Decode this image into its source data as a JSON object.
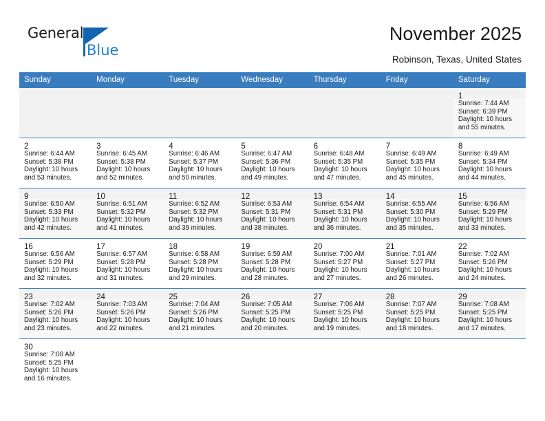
{
  "brand": {
    "name_part1": "General",
    "name_part2": "Blue",
    "triangle_color": "#1265b0",
    "blue_text_color": "#1f7fd0"
  },
  "header": {
    "title": "November 2025",
    "location": "Robinson, Texas, United States"
  },
  "theme": {
    "header_bg": "#3a7dbf",
    "header_text": "#ffffff",
    "cell_band_shaded": "#f2f2f2",
    "row_shaded_bg": "#f7f7f7",
    "grid_line": "#3a7dbf"
  },
  "weekdays": [
    "Sunday",
    "Monday",
    "Tuesday",
    "Wednesday",
    "Thursday",
    "Friday",
    "Saturday"
  ],
  "labels": {
    "sunrise_prefix": "Sunrise: ",
    "sunset_prefix": "Sunset: ",
    "daylight_prefix": "Daylight: "
  },
  "weeks": [
    {
      "shaded": true,
      "days": [
        null,
        null,
        null,
        null,
        null,
        null,
        {
          "day": "1",
          "sunrise": "Sunrise: 7:44 AM",
          "sunset": "Sunset: 6:39 PM",
          "daylight_line1": "Daylight: 10 hours",
          "daylight_line2": "and 55 minutes."
        }
      ]
    },
    {
      "shaded": false,
      "days": [
        {
          "day": "2",
          "sunrise": "Sunrise: 6:44 AM",
          "sunset": "Sunset: 5:38 PM",
          "daylight_line1": "Daylight: 10 hours",
          "daylight_line2": "and 53 minutes."
        },
        {
          "day": "3",
          "sunrise": "Sunrise: 6:45 AM",
          "sunset": "Sunset: 5:38 PM",
          "daylight_line1": "Daylight: 10 hours",
          "daylight_line2": "and 52 minutes."
        },
        {
          "day": "4",
          "sunrise": "Sunrise: 6:46 AM",
          "sunset": "Sunset: 5:37 PM",
          "daylight_line1": "Daylight: 10 hours",
          "daylight_line2": "and 50 minutes."
        },
        {
          "day": "5",
          "sunrise": "Sunrise: 6:47 AM",
          "sunset": "Sunset: 5:36 PM",
          "daylight_line1": "Daylight: 10 hours",
          "daylight_line2": "and 49 minutes."
        },
        {
          "day": "6",
          "sunrise": "Sunrise: 6:48 AM",
          "sunset": "Sunset: 5:35 PM",
          "daylight_line1": "Daylight: 10 hours",
          "daylight_line2": "and 47 minutes."
        },
        {
          "day": "7",
          "sunrise": "Sunrise: 6:49 AM",
          "sunset": "Sunset: 5:35 PM",
          "daylight_line1": "Daylight: 10 hours",
          "daylight_line2": "and 45 minutes."
        },
        {
          "day": "8",
          "sunrise": "Sunrise: 6:49 AM",
          "sunset": "Sunset: 5:34 PM",
          "daylight_line1": "Daylight: 10 hours",
          "daylight_line2": "and 44 minutes."
        }
      ]
    },
    {
      "shaded": true,
      "days": [
        {
          "day": "9",
          "sunrise": "Sunrise: 6:50 AM",
          "sunset": "Sunset: 5:33 PM",
          "daylight_line1": "Daylight: 10 hours",
          "daylight_line2": "and 42 minutes."
        },
        {
          "day": "10",
          "sunrise": "Sunrise: 6:51 AM",
          "sunset": "Sunset: 5:32 PM",
          "daylight_line1": "Daylight: 10 hours",
          "daylight_line2": "and 41 minutes."
        },
        {
          "day": "11",
          "sunrise": "Sunrise: 6:52 AM",
          "sunset": "Sunset: 5:32 PM",
          "daylight_line1": "Daylight: 10 hours",
          "daylight_line2": "and 39 minutes."
        },
        {
          "day": "12",
          "sunrise": "Sunrise: 6:53 AM",
          "sunset": "Sunset: 5:31 PM",
          "daylight_line1": "Daylight: 10 hours",
          "daylight_line2": "and 38 minutes."
        },
        {
          "day": "13",
          "sunrise": "Sunrise: 6:54 AM",
          "sunset": "Sunset: 5:31 PM",
          "daylight_line1": "Daylight: 10 hours",
          "daylight_line2": "and 36 minutes."
        },
        {
          "day": "14",
          "sunrise": "Sunrise: 6:55 AM",
          "sunset": "Sunset: 5:30 PM",
          "daylight_line1": "Daylight: 10 hours",
          "daylight_line2": "and 35 minutes."
        },
        {
          "day": "15",
          "sunrise": "Sunrise: 6:56 AM",
          "sunset": "Sunset: 5:29 PM",
          "daylight_line1": "Daylight: 10 hours",
          "daylight_line2": "and 33 minutes."
        }
      ]
    },
    {
      "shaded": false,
      "days": [
        {
          "day": "16",
          "sunrise": "Sunrise: 6:56 AM",
          "sunset": "Sunset: 5:29 PM",
          "daylight_line1": "Daylight: 10 hours",
          "daylight_line2": "and 32 minutes."
        },
        {
          "day": "17",
          "sunrise": "Sunrise: 6:57 AM",
          "sunset": "Sunset: 5:28 PM",
          "daylight_line1": "Daylight: 10 hours",
          "daylight_line2": "and 31 minutes."
        },
        {
          "day": "18",
          "sunrise": "Sunrise: 6:58 AM",
          "sunset": "Sunset: 5:28 PM",
          "daylight_line1": "Daylight: 10 hours",
          "daylight_line2": "and 29 minutes."
        },
        {
          "day": "19",
          "sunrise": "Sunrise: 6:59 AM",
          "sunset": "Sunset: 5:28 PM",
          "daylight_line1": "Daylight: 10 hours",
          "daylight_line2": "and 28 minutes."
        },
        {
          "day": "20",
          "sunrise": "Sunrise: 7:00 AM",
          "sunset": "Sunset: 5:27 PM",
          "daylight_line1": "Daylight: 10 hours",
          "daylight_line2": "and 27 minutes."
        },
        {
          "day": "21",
          "sunrise": "Sunrise: 7:01 AM",
          "sunset": "Sunset: 5:27 PM",
          "daylight_line1": "Daylight: 10 hours",
          "daylight_line2": "and 26 minutes."
        },
        {
          "day": "22",
          "sunrise": "Sunrise: 7:02 AM",
          "sunset": "Sunset: 5:26 PM",
          "daylight_line1": "Daylight: 10 hours",
          "daylight_line2": "and 24 minutes."
        }
      ]
    },
    {
      "shaded": true,
      "days": [
        {
          "day": "23",
          "sunrise": "Sunrise: 7:02 AM",
          "sunset": "Sunset: 5:26 PM",
          "daylight_line1": "Daylight: 10 hours",
          "daylight_line2": "and 23 minutes."
        },
        {
          "day": "24",
          "sunrise": "Sunrise: 7:03 AM",
          "sunset": "Sunset: 5:26 PM",
          "daylight_line1": "Daylight: 10 hours",
          "daylight_line2": "and 22 minutes."
        },
        {
          "day": "25",
          "sunrise": "Sunrise: 7:04 AM",
          "sunset": "Sunset: 5:26 PM",
          "daylight_line1": "Daylight: 10 hours",
          "daylight_line2": "and 21 minutes."
        },
        {
          "day": "26",
          "sunrise": "Sunrise: 7:05 AM",
          "sunset": "Sunset: 5:25 PM",
          "daylight_line1": "Daylight: 10 hours",
          "daylight_line2": "and 20 minutes."
        },
        {
          "day": "27",
          "sunrise": "Sunrise: 7:06 AM",
          "sunset": "Sunset: 5:25 PM",
          "daylight_line1": "Daylight: 10 hours",
          "daylight_line2": "and 19 minutes."
        },
        {
          "day": "28",
          "sunrise": "Sunrise: 7:07 AM",
          "sunset": "Sunset: 5:25 PM",
          "daylight_line1": "Daylight: 10 hours",
          "daylight_line2": "and 18 minutes."
        },
        {
          "day": "29",
          "sunrise": "Sunrise: 7:08 AM",
          "sunset": "Sunset: 5:25 PM",
          "daylight_line1": "Daylight: 10 hours",
          "daylight_line2": "and 17 minutes."
        }
      ]
    },
    {
      "shaded": false,
      "days": [
        {
          "day": "30",
          "sunrise": "Sunrise: 7:08 AM",
          "sunset": "Sunset: 5:25 PM",
          "daylight_line1": "Daylight: 10 hours",
          "daylight_line2": "and 16 minutes."
        },
        null,
        null,
        null,
        null,
        null,
        null
      ]
    }
  ]
}
